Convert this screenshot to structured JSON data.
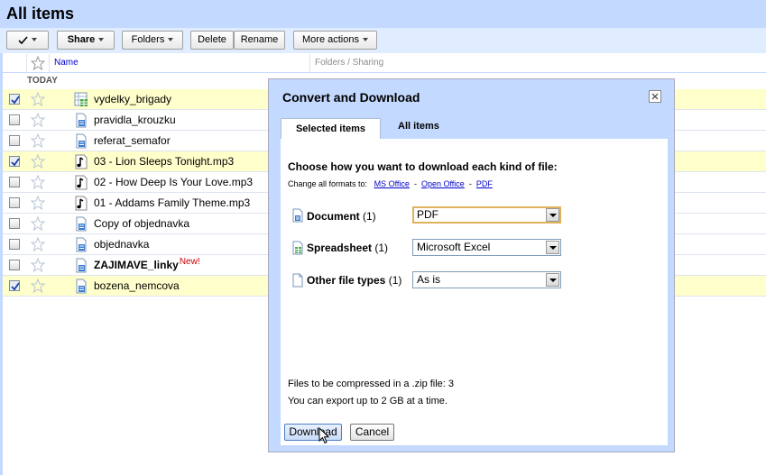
{
  "header": {
    "title": "All items"
  },
  "toolbar": {
    "share": "Share",
    "folders": "Folders",
    "delete": "Delete",
    "rename": "Rename",
    "more_actions": "More actions"
  },
  "list": {
    "columns": {
      "name": "Name",
      "folders": "Folders / Sharing"
    },
    "group_label": "TODAY",
    "rows": [
      {
        "name": "vydelky_brigady",
        "type": "spreadsheet",
        "checked": true
      },
      {
        "name": "pravidla_krouzku",
        "type": "document",
        "checked": false
      },
      {
        "name": "referat_semafor",
        "type": "document",
        "checked": false
      },
      {
        "name": "03 - Lion Sleeps Tonight.mp3",
        "type": "audio",
        "checked": true
      },
      {
        "name": "02 - How Deep Is Your Love.mp3",
        "type": "audio",
        "checked": false
      },
      {
        "name": "01 - Addams Family Theme.mp3",
        "type": "audio",
        "checked": false
      },
      {
        "name": "Copy of objednavka",
        "type": "document",
        "checked": false
      },
      {
        "name": "objednavka",
        "type": "document",
        "checked": false
      },
      {
        "name": "ZAJIMAVE_linky",
        "type": "document",
        "checked": false,
        "badge": "New!"
      },
      {
        "name": "bozena_nemcova",
        "type": "document",
        "checked": true
      }
    ]
  },
  "dialog": {
    "title": "Convert and Download",
    "tabs": {
      "selected": "Selected items",
      "all": "All items"
    },
    "heading": "Choose how you want to download each kind of file:",
    "change_all": "Change all formats to:",
    "links": {
      "ms": "MS Office",
      "sep1": "-",
      "oo": "Open Office",
      "sep2": "-",
      "pdf": "PDF"
    },
    "types": [
      {
        "label": "Document",
        "count": "(1)",
        "value": "PDF",
        "icon": "document-icon"
      },
      {
        "label": "Spreadsheet",
        "count": "(1)",
        "value": "Microsoft Excel",
        "icon": "spreadsheet-icon"
      },
      {
        "label": "Other file types",
        "count": "(1)",
        "value": "As is",
        "icon": "file-icon"
      }
    ],
    "compress_note": "Files to be compressed in a .zip file: 3",
    "limit_note": "You can export up to 2 GB at a time.",
    "download": "Download",
    "cancel": "Cancel"
  },
  "colors": {
    "header_bg": "#c3d9ff",
    "toolbar_bg": "#e0ecff",
    "selected_row": "#ffffcc",
    "link": "#0000cc",
    "new_badge": "#cc0000"
  }
}
